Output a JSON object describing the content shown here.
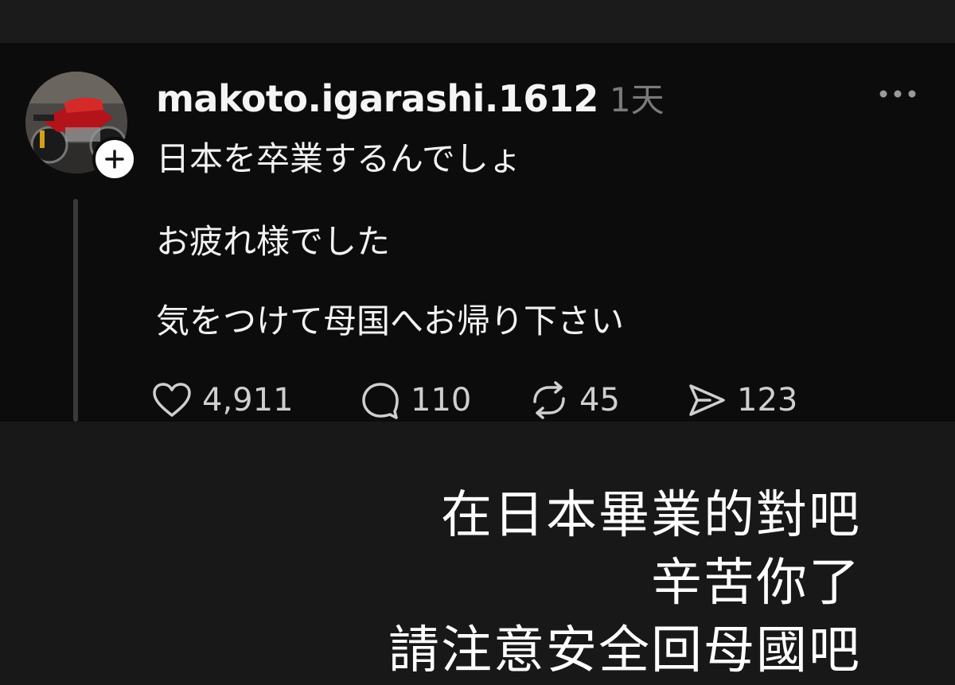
{
  "post": {
    "username": "makoto.igarashi.1612",
    "time": "1天",
    "lines": [
      "日本を卒業するんでしょ",
      "お疲れ様でした",
      "気をつけて母国へお帰り下さい"
    ],
    "actions": {
      "likes": "4,911",
      "replies": "110",
      "reposts": "45",
      "shares": "123"
    }
  },
  "caption": {
    "lines": [
      "在日本畢業的對吧",
      "辛苦你了",
      "請注意安全回母國吧"
    ]
  },
  "icons": {
    "avatar": "motorcycle-photo",
    "follow": "plus-icon",
    "more": "more-dots-icon",
    "like": "heart-icon",
    "reply": "comment-icon",
    "repost": "repost-icon",
    "share": "send-icon"
  },
  "colors": {
    "post_background": "#0c0c0c",
    "page_background": "#181818",
    "text_primary": "#f5f5f5",
    "text_secondary": "#7a7a7a"
  }
}
